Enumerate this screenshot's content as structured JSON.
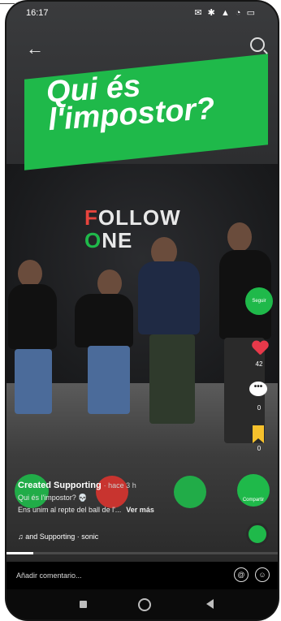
{
  "status": {
    "time": "16:17",
    "icons": "✉ ✱ ▲ ◔ ▭"
  },
  "video": {
    "banner": {
      "line1": "Qui és",
      "line2": "l'impostor?"
    },
    "wall_text": {
      "l1a": "F",
      "l1b": "OLLOW",
      "l2a": "O",
      "l2b": "NE"
    }
  },
  "sidebar": {
    "follow_label": "Seguir",
    "likes": "42",
    "comments": "0",
    "saves": "0",
    "share_label": "Compartir"
  },
  "caption": {
    "author": "Created Supporting",
    "time": "· hace 3 h",
    "line1": "Qui és l'impostor? 💀",
    "line2": "Ens unim al repte del ball de l'...",
    "more": "Ver más",
    "music": "♫ and Supporting · sonic"
  },
  "progress": 0.1,
  "comment_bar": {
    "placeholder": "Añadir comentario...",
    "at_icon": "@",
    "emoji_icon": "☺"
  },
  "colors": {
    "accent": "#1fb94a",
    "like": "#e8394a",
    "bookmark": "#f6c12c"
  },
  "icons": [
    "back-arrow-icon",
    "search-icon",
    "heart-icon",
    "comment-icon",
    "bookmark-icon",
    "share-icon",
    "music-disc-icon",
    "at-icon",
    "emoji-icon"
  ]
}
